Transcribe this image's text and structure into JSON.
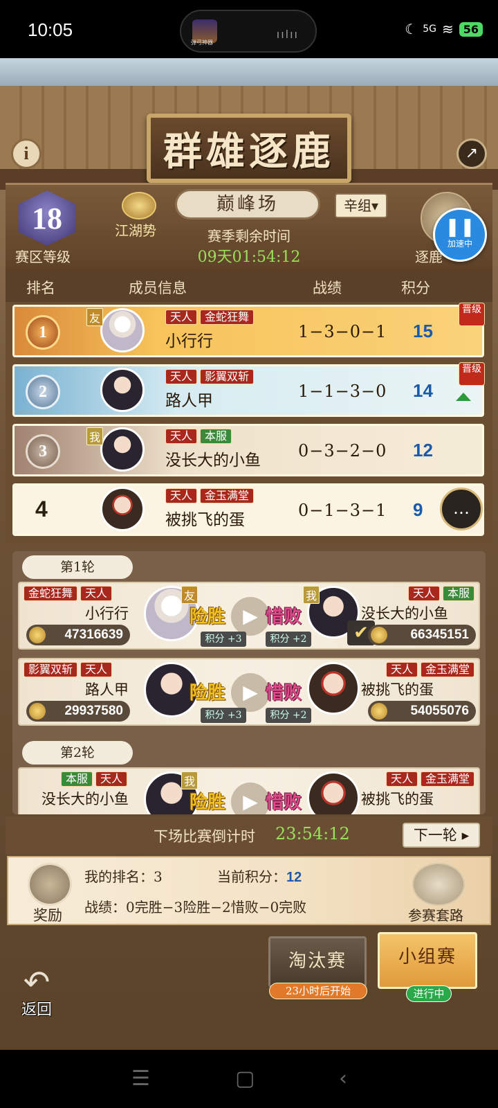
{
  "status_bar": {
    "time": "10:05",
    "app_name": "弹弓神器",
    "signal_label": "5G",
    "battery": "56"
  },
  "header": {
    "title": "群雄逐鹿",
    "region_level": "18",
    "region_level_label": "赛区等级",
    "jianghu_label": "江湖势",
    "arena_name": "巅峰场",
    "group_selector": "辛组▾",
    "season_label": "赛季剩余时间",
    "season_time": "09天01:54:12",
    "zhulu_label": "逐鹿",
    "speed_label": "加速中"
  },
  "ranking": {
    "columns": [
      "排名",
      "成员信息",
      "战绩",
      "积分"
    ],
    "rows": [
      {
        "rank": "1",
        "tag": "友",
        "badges": [
          "天人",
          "金蛇狂舞"
        ],
        "name": "小行行",
        "record": "1−3−0−1",
        "score": "15",
        "promo": "晋级"
      },
      {
        "rank": "2",
        "tag": "",
        "badges": [
          "天人",
          "影翼双斩"
        ],
        "name": "路人甲",
        "record": "1−1−3−0",
        "score": "14",
        "promo": "晋级"
      },
      {
        "rank": "3",
        "tag": "我",
        "badges": [
          "天人",
          "本服"
        ],
        "name": "没长大的小鱼",
        "record": "0−3−2−0",
        "score": "12",
        "promo": ""
      },
      {
        "rank": "4",
        "tag": "",
        "badges": [
          "天人",
          "金玉满堂"
        ],
        "name": "被挑飞的蛋",
        "record": "0−1−3−1",
        "score": "9",
        "promo": ""
      }
    ]
  },
  "matches": {
    "round1_label": "第1轮",
    "round2_label": "第2轮",
    "win_label": "险胜",
    "lose_label": "惜败",
    "list": [
      {
        "left_badges": [
          "金蛇狂舞",
          "天人"
        ],
        "left_name": "小行行",
        "left_tag": "友",
        "left_power": "47316639",
        "left_pts": "积分 +3",
        "right_badges": [
          "天人",
          "本服"
        ],
        "right_name": "没长大的小鱼",
        "right_tag": "我",
        "right_power": "66345151",
        "right_pts": "积分 +2"
      },
      {
        "left_badges": [
          "影翼双斩",
          "天人"
        ],
        "left_name": "路人甲",
        "left_power": "29937580",
        "left_pts": "积分 +3",
        "right_badges": [
          "天人",
          "金玉满堂"
        ],
        "right_name": "被挑飞的蛋",
        "right_power": "54055076",
        "right_pts": "积分 +2"
      },
      {
        "left_badges": [
          "本服",
          "天人"
        ],
        "left_name": "没长大的小鱼",
        "left_tag": "我",
        "right_badges": [
          "天人",
          "金玉满堂"
        ],
        "right_name": "被挑飞的蛋"
      }
    ]
  },
  "countdown": {
    "label": "下场比赛倒计时",
    "time": "23:54:12",
    "next_round": "下一轮 ▸"
  },
  "summary": {
    "reward_label": "奖励",
    "my_rank": "我的排名：3",
    "current_score_label": "当前积分：",
    "current_score": "12",
    "record": "战绩：0完胜−3险胜−2惜败−0完败",
    "strategy_label": "参赛套路"
  },
  "tabs": {
    "knockout": "淘汰赛",
    "knockout_status": "23小时后开始",
    "group": "小组赛",
    "group_status": "进行中"
  },
  "back_label": "返回"
}
